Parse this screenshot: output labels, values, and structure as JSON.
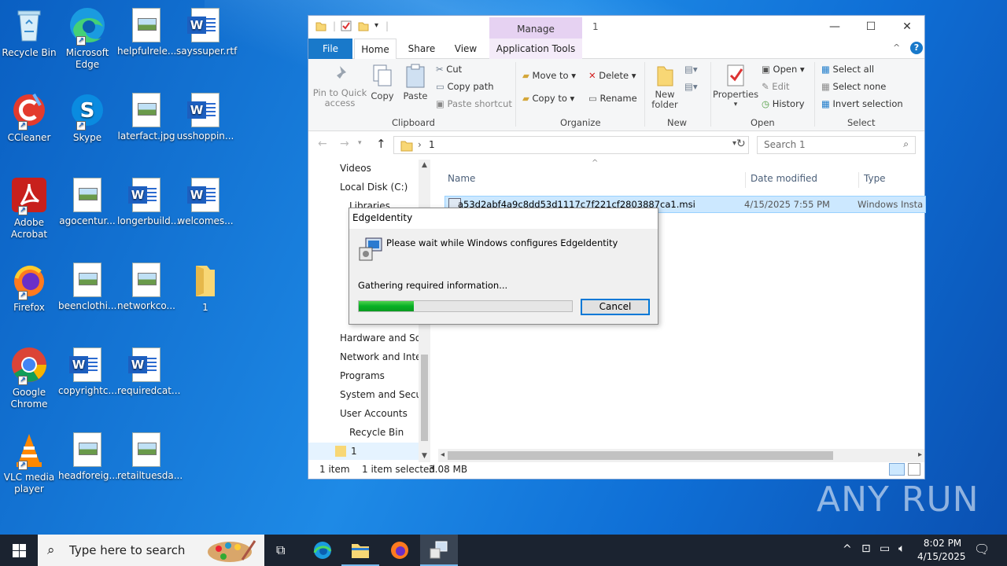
{
  "desktop_icons": [
    {
      "label": "Recycle Bin"
    },
    {
      "label": "Microsoft Edge"
    },
    {
      "label": "helpfulrele..."
    },
    {
      "label": "sayssuper.rtf"
    },
    {
      "label": "CCleaner"
    },
    {
      "label": "Skype"
    },
    {
      "label": "laterfact.jpg"
    },
    {
      "label": "usshoppin..."
    },
    {
      "label": "Adobe Acrobat"
    },
    {
      "label": "agocentur..."
    },
    {
      "label": "longerbuild..."
    },
    {
      "label": "welcomes..."
    },
    {
      "label": "Firefox"
    },
    {
      "label": "beenclothi..."
    },
    {
      "label": "networkco..."
    },
    {
      "label": "1"
    },
    {
      "label": "Google Chrome"
    },
    {
      "label": "copyrightc..."
    },
    {
      "label": "requiredcat..."
    },
    {
      "label": "VLC media player"
    },
    {
      "label": "headforeig..."
    },
    {
      "label": "retailtuesda..."
    }
  ],
  "explorer": {
    "manage_tab": "Manage",
    "window_title": "1",
    "tabs": {
      "file": "File",
      "home": "Home",
      "share": "Share",
      "view": "View",
      "app_tools": "Application Tools"
    },
    "ribbon": {
      "pin": "Pin to Quick access",
      "copy": "Copy",
      "paste": "Paste",
      "cut": "Cut",
      "copy_path": "Copy path",
      "paste_shortcut": "Paste shortcut",
      "clipboard": "Clipboard",
      "move_to": "Move to",
      "copy_to": "Copy to",
      "delete": "Delete",
      "rename": "Rename",
      "organize": "Organize",
      "new_folder": "New folder",
      "new": "New",
      "properties": "Properties",
      "open": "Open",
      "edit": "Edit",
      "history": "History",
      "open_group": "Open",
      "select_all": "Select all",
      "select_none": "Select none",
      "invert_selection": "Invert selection",
      "select": "Select"
    },
    "address": {
      "crumb": "1",
      "search_placeholder": "Search 1"
    },
    "nav": [
      {
        "label": "Videos"
      },
      {
        "label": "Local Disk (C:)"
      },
      {
        "label": "Libraries"
      },
      {
        "label": "Hardware and Sound"
      },
      {
        "label": "Network and Internet"
      },
      {
        "label": "Programs"
      },
      {
        "label": "System and Security"
      },
      {
        "label": "User Accounts"
      },
      {
        "label": "Recycle Bin"
      },
      {
        "label": "1"
      }
    ],
    "columns": {
      "name": "Name",
      "date": "Date modified",
      "type": "Type"
    },
    "file": {
      "name": "a53d2abf4a9c8dd53d1117c7f221cf2803887ca1.msi",
      "date": "4/15/2025 7:55 PM",
      "type": "Windows Insta"
    },
    "status": {
      "count": "1 item",
      "selected": "1 item selected",
      "size": "3.08 MB"
    }
  },
  "dialog": {
    "title": "EdgeIdentity",
    "message": "Please wait while Windows configures EdgeIdentity",
    "status": "Gathering required information...",
    "progress": 0.26,
    "cancel": "Cancel"
  },
  "taskbar": {
    "search_placeholder": "Type here to search",
    "time": "8:02 PM",
    "date": "4/15/2025"
  },
  "watermark": "ANY RUN",
  "colors": {
    "file_tab": "#1979ca",
    "selection": "#cce8ff",
    "progress": "#06b025",
    "taskbar": "#1b2330"
  }
}
